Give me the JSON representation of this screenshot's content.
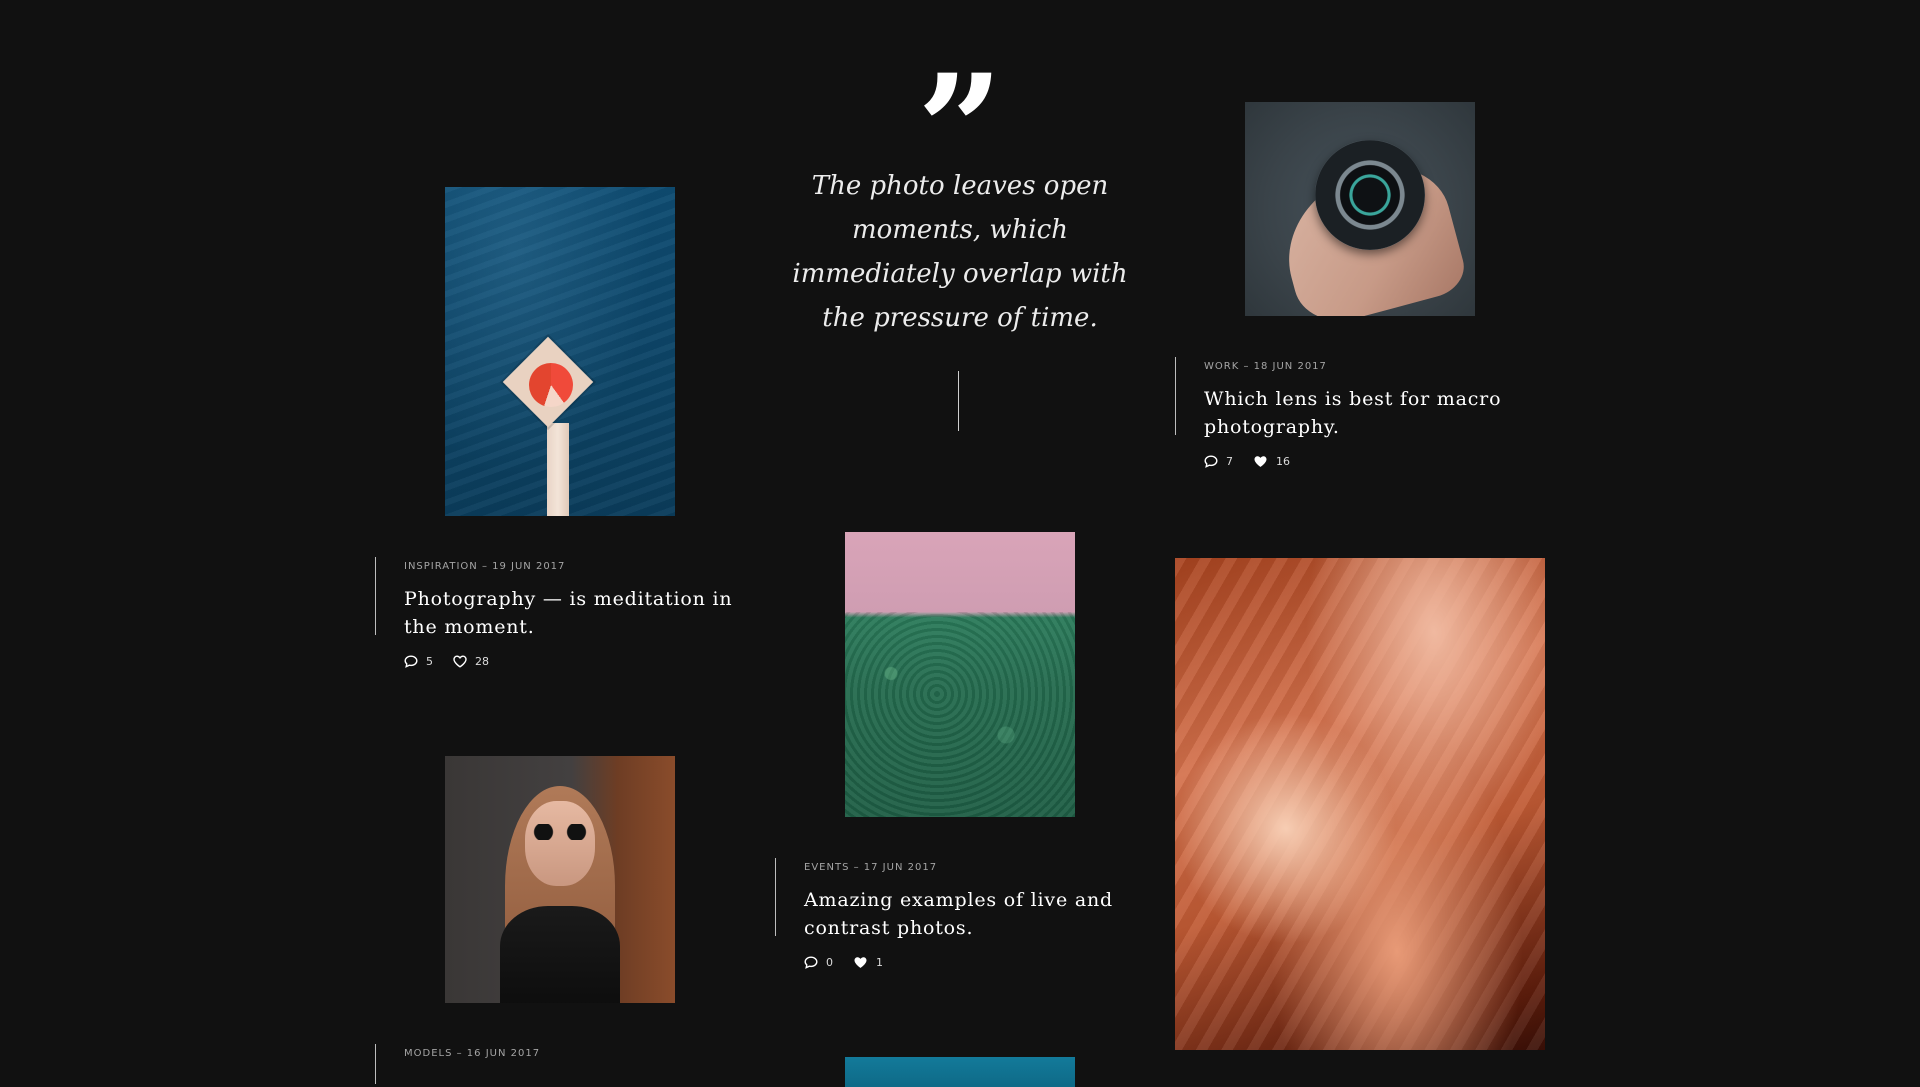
{
  "quote": {
    "mark": "”",
    "text": "The photo leaves open moments, which immediately overlap with the pressure of time."
  },
  "posts": [
    {
      "meta": "INSPIRATION – 19 JUN 2017",
      "title": "Photography — is meditation in the moment.",
      "comments": "5",
      "likes": "28",
      "liked": false
    },
    {
      "meta": "WORK – 18 JUN 2017",
      "title": "Which lens is best for macro photography.",
      "comments": "7",
      "likes": "16",
      "liked": true
    },
    {
      "meta": "EVENTS – 17 JUN 2017",
      "title": "Amazing examples of live and contrast photos.",
      "comments": "0",
      "likes": "1",
      "liked": true
    },
    {
      "meta": "MODELS – 16 JUN 2017",
      "title": "",
      "comments": "",
      "likes": "",
      "liked": false
    }
  ],
  "colors": {
    "background": "#111111",
    "text": "#ffffff",
    "meta": "#a5a5a5"
  },
  "icons": {
    "comment": "comment-icon",
    "heart_outline": "heart-outline-icon",
    "heart_filled": "heart-filled-icon",
    "quote": "quote-icon"
  }
}
